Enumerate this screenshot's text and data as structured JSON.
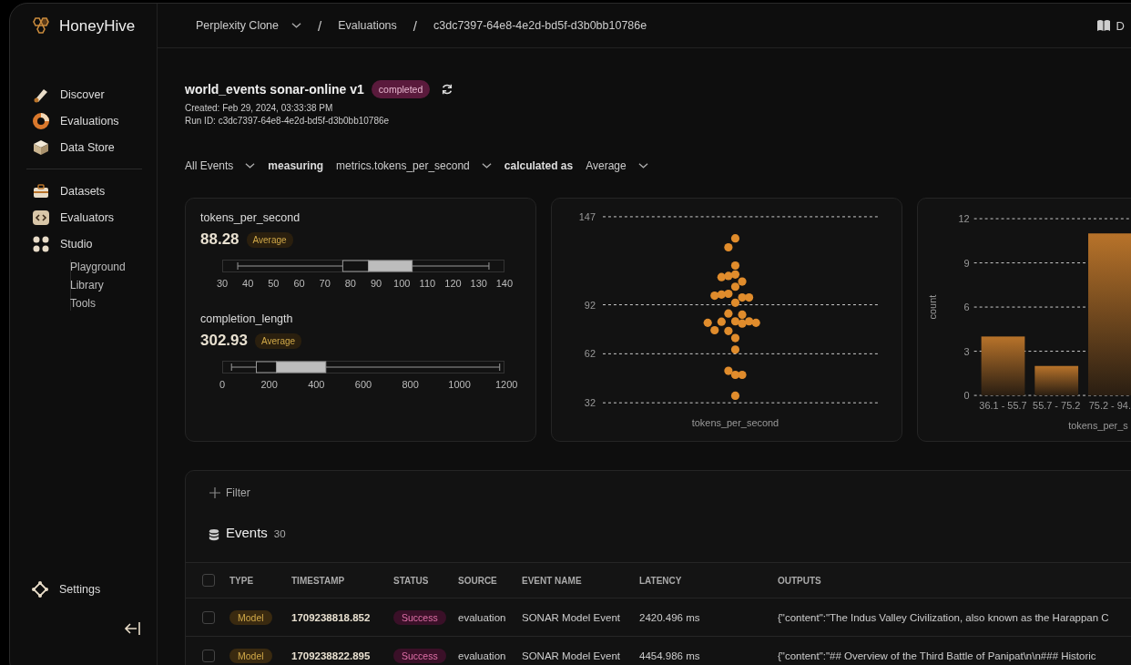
{
  "brand": "HoneyHive",
  "nav_primary": [
    {
      "label": "Discover",
      "kind": "discover"
    },
    {
      "label": "Evaluations",
      "kind": "evaluations"
    },
    {
      "label": "Data Store",
      "kind": "datastore"
    }
  ],
  "nav_secondary": [
    {
      "label": "Datasets",
      "kind": "datasets"
    },
    {
      "label": "Evaluators",
      "kind": "evaluators"
    },
    {
      "label": "Studio",
      "kind": "studio",
      "children": [
        {
          "label": "Playground"
        },
        {
          "label": "Library"
        },
        {
          "label": "Tools"
        }
      ]
    }
  ],
  "settings": "Settings",
  "breadcrumb": {
    "project": "Perplexity Clone",
    "section": "Evaluations",
    "run": "c3dc7397-64e8-4e2d-bd5f-d3b0bb10786e",
    "separator": "/"
  },
  "docs": "D",
  "run": {
    "title": "world_events sonar-online v1",
    "status": "completed",
    "created": "Created: Feb 29, 2024, 03:33:38 PM",
    "run_id": "Run ID: c3dc7397-64e8-4e2d-bd5f-d3b0bb10786e"
  },
  "filters": {
    "scope": "All Events",
    "measuring_label": "measuring",
    "metric": "metrics.tokens_per_second",
    "calc_label": "calculated as",
    "calc": "Average"
  },
  "metrics": [
    {
      "name": "tokens_per_second",
      "value": "88.28",
      "aggregate": "Average",
      "ticks": [
        "30",
        "40",
        "50",
        "60",
        "70",
        "80",
        "90",
        "100",
        "110",
        "120",
        "130",
        "140"
      ]
    },
    {
      "name": "completion_length",
      "value": "302.93",
      "aggregate": "Average",
      "ticks": [
        "0",
        "200",
        "400",
        "600",
        "800",
        "1000",
        "1200"
      ]
    }
  ],
  "strip_chart": {
    "y_ticks": [
      "147",
      "92",
      "62",
      "32"
    ],
    "axis_label": "tokens_per_second"
  },
  "histogram": {
    "chart_data": {
      "type": "bar",
      "xlabel": "tokens_per_s",
      "ylabel": "count",
      "categories": [
        "36.1 - 55.7",
        "55.7 - 75.2",
        "75.2 - 94."
      ],
      "yticks": [
        0,
        3,
        6,
        9,
        12
      ],
      "ylim": [
        0,
        12
      ],
      "grid": true,
      "series": [
        {
          "color": "#b8732a",
          "values": [
            4,
            2,
            11
          ]
        }
      ]
    }
  },
  "filter_button": "Filter",
  "events": {
    "title": "Events",
    "count": "30",
    "select_all": {
      "checked": false
    },
    "columns": [
      "TYPE",
      "TIMESTAMP",
      "STATUS",
      "SOURCE",
      "EVENT NAME",
      "LATENCY",
      "OUTPUTS"
    ],
    "rows": [
      {
        "checked": false,
        "type": "Model",
        "timestamp": "1709238818.852",
        "status": "Success",
        "source": "evaluation",
        "event_name": "SONAR Model Event",
        "latency": "2420.496 ms",
        "outputs": "{\"content\":\"The Indus Valley Civilization, also known as the Harappan C"
      },
      {
        "checked": false,
        "type": "Model",
        "timestamp": "1709238822.895",
        "status": "Success",
        "source": "evaluation",
        "event_name": "SONAR Model Event",
        "latency": "4454.986 ms",
        "outputs": "{\"content\":\"## Overview of the Third Battle of Panipat\\n\\n### Historic"
      }
    ]
  }
}
